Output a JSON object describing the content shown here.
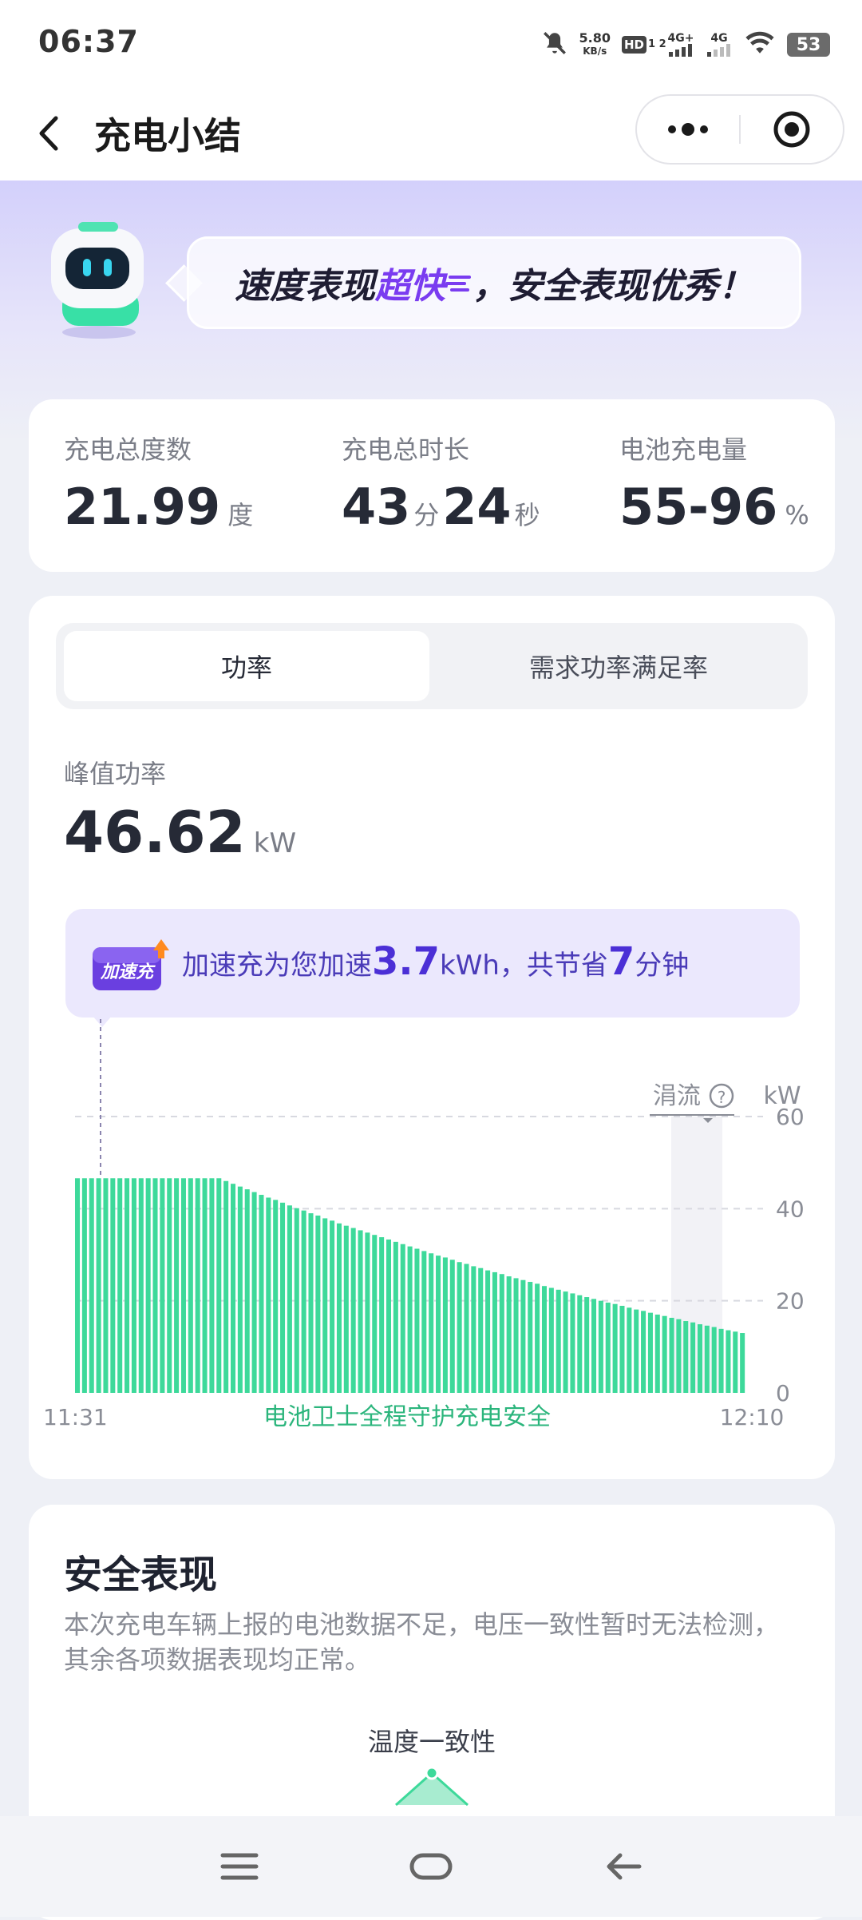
{
  "status_bar": {
    "time": "06:37",
    "net_speed_value": "5.80",
    "net_speed_unit": "KB/s",
    "hd_label": "HD",
    "hd_sub": "1 2",
    "sig1_label": "4G+",
    "sig2_label": "4G",
    "battery": "53"
  },
  "nav": {
    "title": "充电小结"
  },
  "hero": {
    "message_prefix": "速度表现",
    "message_highlight": "超快",
    "message_suffix": "，安全表现优秀！"
  },
  "stats": {
    "energy_label": "充电总度数",
    "energy_value": "21.99",
    "energy_unit": "度",
    "duration_label": "充电总时长",
    "duration_min": "43",
    "duration_min_unit": "分",
    "duration_sec": "24",
    "duration_sec_unit": "秒",
    "battery_label": "电池充电量",
    "battery_value": "55-96",
    "battery_unit": "%"
  },
  "tabs": {
    "power": "功率",
    "demand": "需求功率满足率"
  },
  "peak": {
    "label": "峰值功率",
    "value": "46.62",
    "unit": "kW"
  },
  "boost": {
    "badge": "加速充",
    "text_prefix": "加速充为您加速",
    "energy": "3.7",
    "energy_unit": "kWh，共节省",
    "minutes": "7",
    "minutes_unit": "分钟"
  },
  "chart_data": {
    "type": "bar",
    "unit_label": "kW",
    "trickle_label": "涓流",
    "x_start_label": "11:31",
    "x_end_label": "12:10",
    "footer_label": "电池卫士全程守护充电安全",
    "ylim": [
      0,
      60
    ],
    "yticks": [
      0,
      20,
      40,
      60
    ],
    "bar_color": "#3dd99a",
    "values": [
      46.6,
      46.6,
      46.6,
      46.6,
      46.6,
      46.6,
      46.6,
      46.6,
      46.6,
      46.6,
      46.6,
      46.6,
      46.6,
      46.6,
      46.6,
      46.6,
      46.6,
      46.6,
      46.6,
      46.6,
      46.6,
      46.0,
      45.4,
      44.8,
      44.2,
      43.6,
      43.0,
      42.4,
      41.9,
      41.3,
      40.7,
      40.1,
      39.6,
      39.0,
      38.5,
      37.9,
      37.4,
      36.8,
      36.3,
      35.8,
      35.3,
      34.8,
      34.3,
      33.8,
      33.3,
      32.8,
      32.3,
      31.8,
      31.3,
      30.8,
      30.3,
      29.8,
      29.4,
      28.9,
      28.4,
      28.0,
      27.5,
      27.1,
      26.6,
      26.2,
      25.8,
      25.3,
      24.9,
      24.5,
      24.1,
      23.7,
      23.2,
      22.8,
      22.4,
      22.0,
      21.6,
      21.2,
      20.8,
      20.4,
      20.0,
      19.6,
      19.3,
      18.9,
      18.5,
      18.1,
      17.8,
      17.4,
      17.0,
      16.7,
      16.3,
      16.0,
      15.6,
      15.3,
      14.9,
      14.6,
      14.3,
      13.9,
      13.6,
      13.3,
      13.0
    ]
  },
  "safety": {
    "title": "安全表现",
    "description": "本次充电车辆上报的电池数据不足，电压一致性暂时无法检测， 其余各项数据表现均正常。",
    "temp_label": "温度一致性"
  }
}
